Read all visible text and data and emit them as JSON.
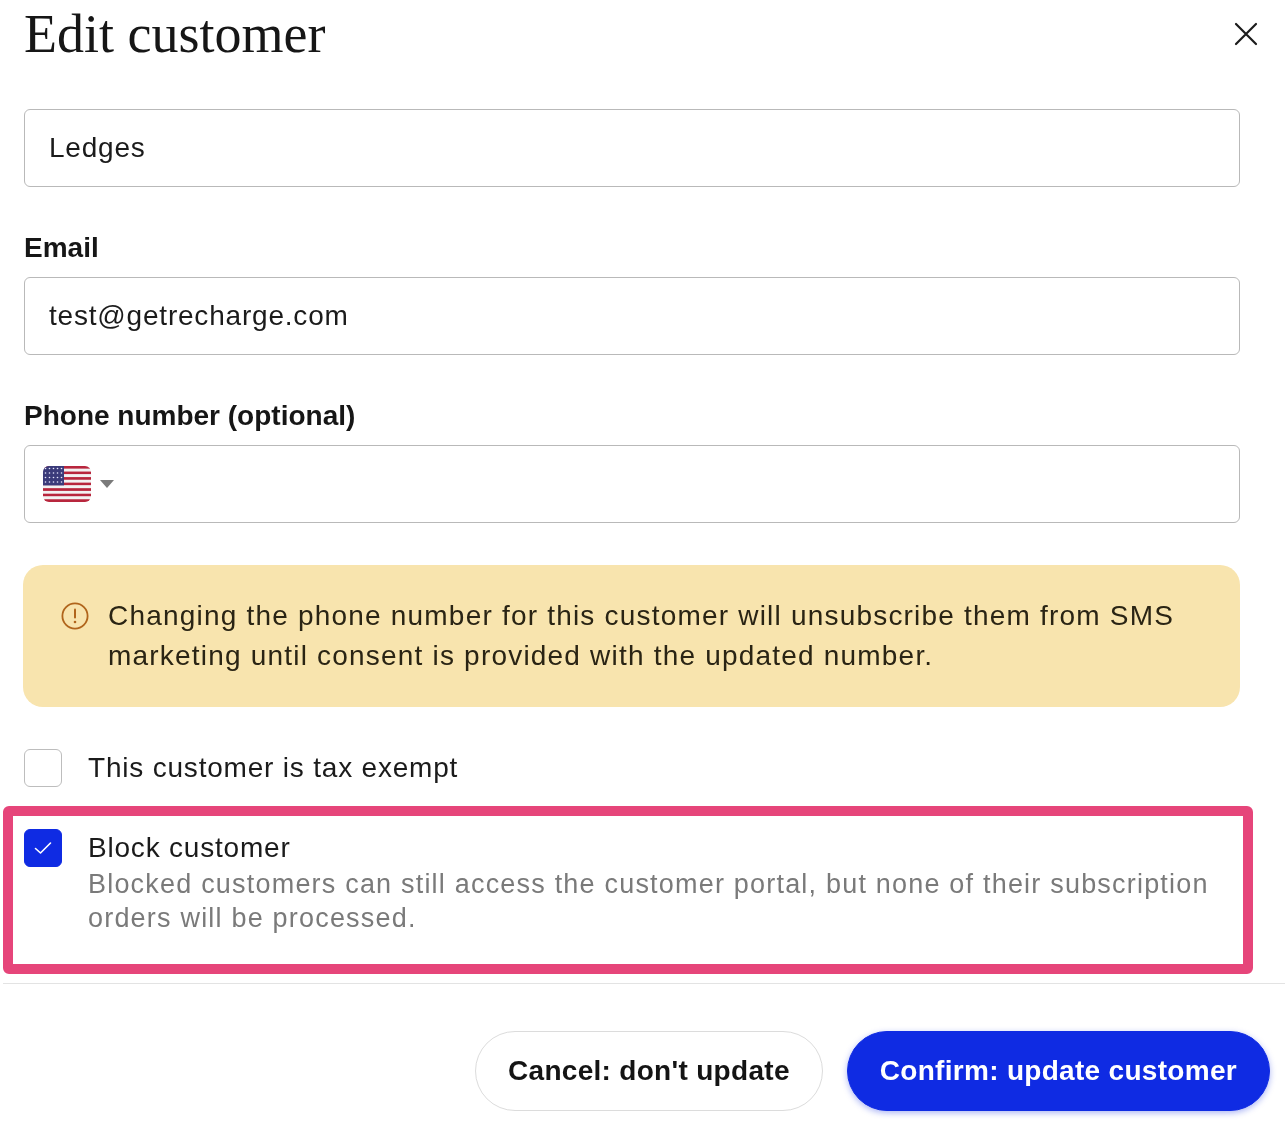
{
  "dialog": {
    "title": "Edit customer"
  },
  "fields": [
    {
      "kind": "text",
      "value": "Ledges"
    },
    {
      "kind": "text",
      "label": "Email",
      "value": "test@getrecharge.com"
    },
    {
      "kind": "phone",
      "label": "Phone number (optional)"
    }
  ],
  "alert": {
    "text": "Changing the phone number for this customer will unsubscribe them from SMS marketing until consent is provided with the updated number."
  },
  "checkboxes": [
    {
      "label": "This customer is tax exempt",
      "checked": false,
      "highlighted": false
    },
    {
      "label": "Block customer",
      "description": "Blocked customers can still access the customer portal, but none of their subscription orders will be processed.",
      "checked": true,
      "highlighted": true
    }
  ],
  "buttons": [
    {
      "label": "Cancel: don't update",
      "kind": "secondary"
    },
    {
      "label": "Confirm: update customer",
      "kind": "primary"
    }
  ]
}
